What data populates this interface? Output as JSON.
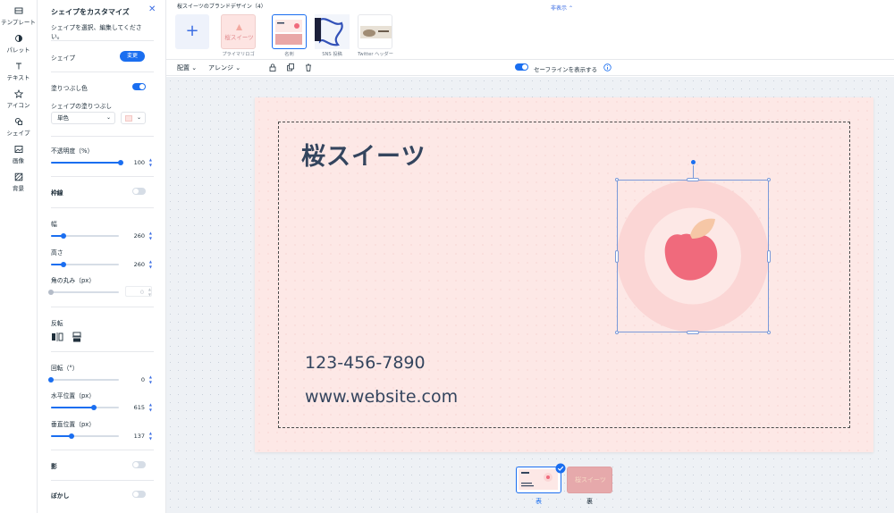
{
  "rail": {
    "items": [
      {
        "label": "テンプレート",
        "icon": "template-icon"
      },
      {
        "label": "パレット",
        "icon": "palette-icon"
      },
      {
        "label": "テキスト",
        "icon": "text-icon"
      },
      {
        "label": "アイコン",
        "icon": "star-icon"
      },
      {
        "label": "シェイプ",
        "icon": "shapes-icon"
      },
      {
        "label": "画像",
        "icon": "image-icon"
      },
      {
        "label": "背景",
        "icon": "background-icon"
      }
    ]
  },
  "panel": {
    "title": "シェイプをカスタマイズ",
    "subtitle": "シェイプを選択、編集してください。",
    "shape_label": "シェイプ",
    "change_button": "変更",
    "fill_label": "塗りつぶし色",
    "fill_on": true,
    "shape_fill_label": "シェイプの塗りつぶし",
    "fill_mode": "単色",
    "fill_color": "#fde4e2",
    "opacity_label": "不透明度（%）",
    "opacity_value": "100",
    "border_label": "枠線",
    "border_on": false,
    "width_label": "幅",
    "width_value": "260",
    "height_label": "高さ",
    "height_value": "260",
    "corner_label": "角の丸み（px）",
    "corner_value": "0",
    "flip_label": "反転",
    "rotate_label": "回転（°）",
    "rotate_value": "0",
    "x_label": "水平位置（px）",
    "x_value": "615",
    "y_label": "垂直位置（px）",
    "y_value": "137",
    "shadow_label": "影",
    "shadow_on": false,
    "blur_label": "ぼかし",
    "blur_on": false
  },
  "topbar": {
    "title": "桜スイーツのブランドデザイン（4）",
    "hide_label": "非表示",
    "thumbs": [
      {
        "label": "プライマリロゴ",
        "text": "桜スイーツ"
      },
      {
        "label": "名刺"
      },
      {
        "label": "SNS 投稿"
      },
      {
        "label": "Twitter ヘッダー"
      }
    ]
  },
  "toolbar": {
    "arrange_label": "配置",
    "align_label": "アレンジ",
    "safe_line_label": "セーフラインを表示する",
    "safe_line_on": true
  },
  "card": {
    "title": "桜スイーツ",
    "phone": "123-456-7890",
    "website": "www.website.com",
    "bg_color": "#fde8e6",
    "ring_outer": "#fbd6d5",
    "ring_inner": "#fde8e6",
    "apple_color": "#f06a7c",
    "leaf_color": "#f6c7a6"
  },
  "pages": {
    "front_label": "表",
    "back_label": "裏",
    "back_text": "桜スイーツ"
  },
  "colors": {
    "accent": "#1a6ef0",
    "text": "#34455e"
  }
}
